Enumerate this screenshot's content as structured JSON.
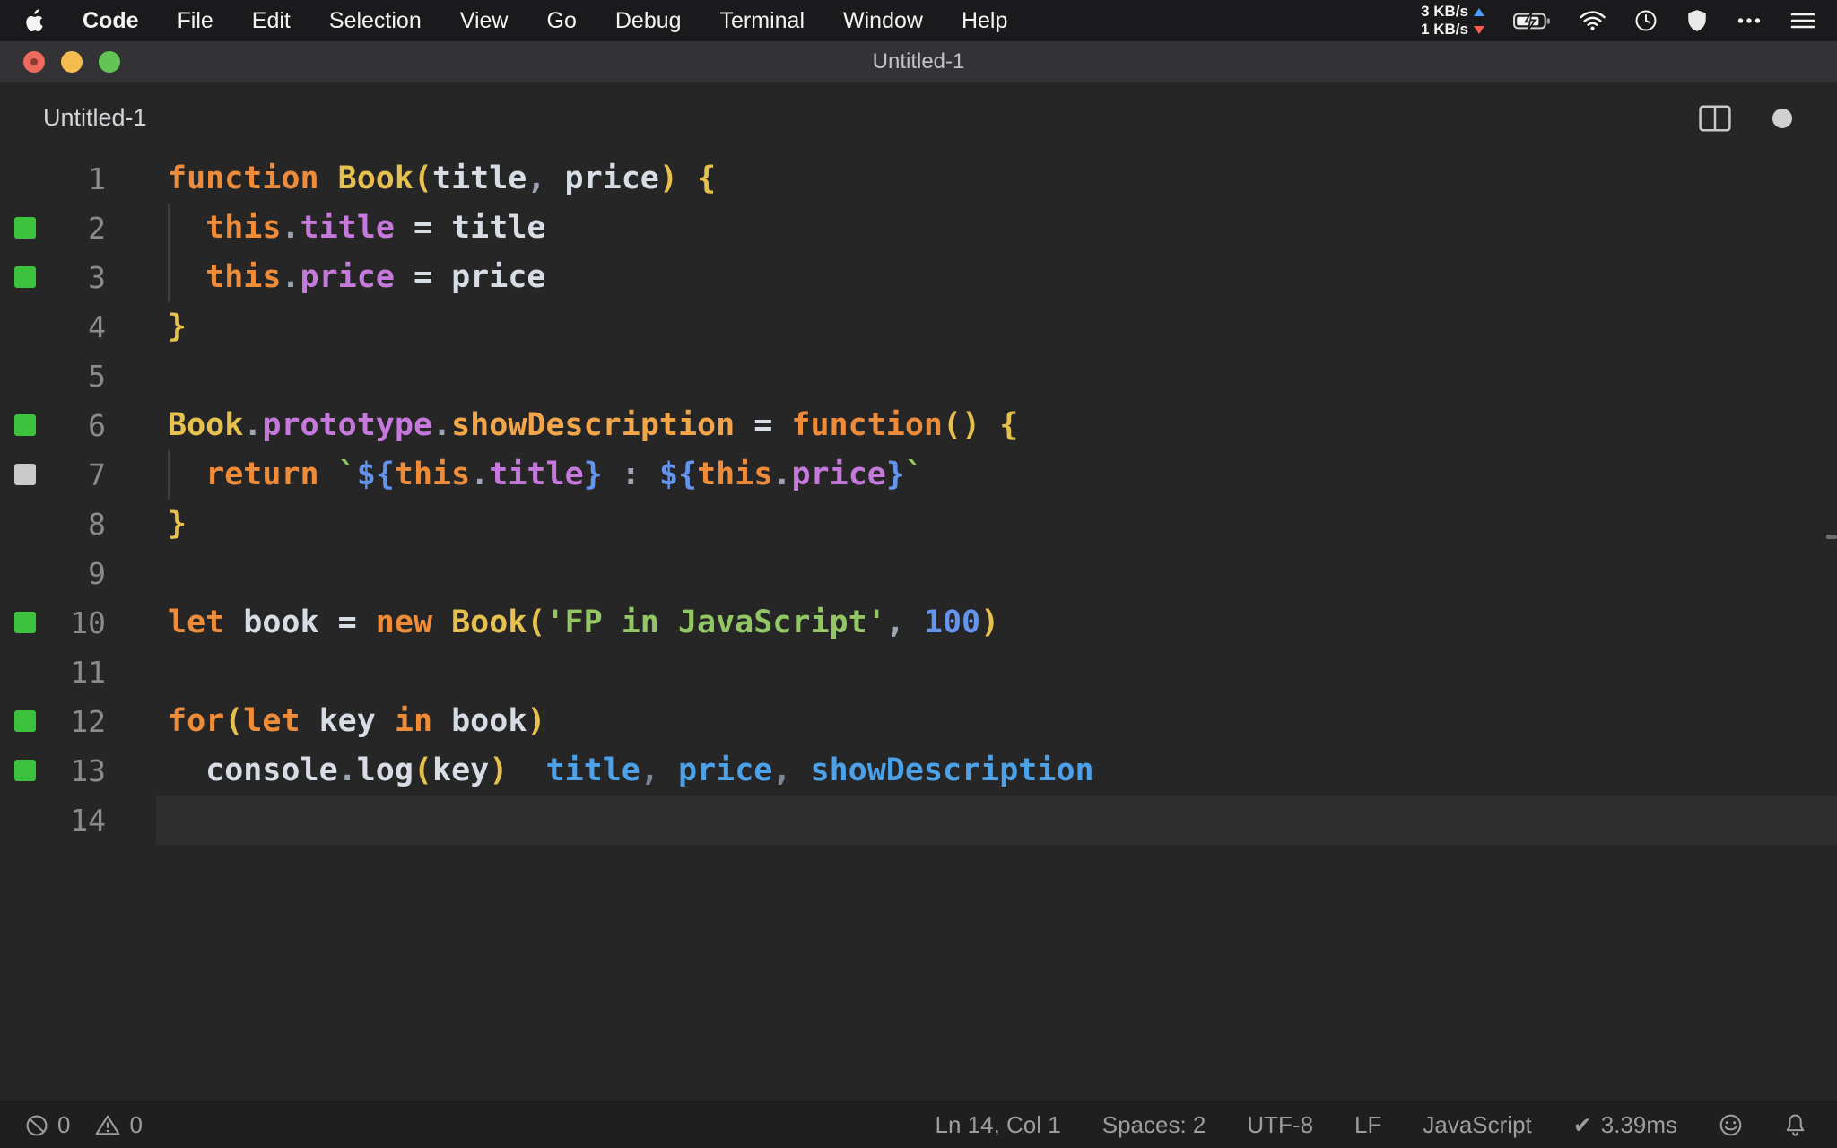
{
  "menubar": {
    "app_menu": "Code",
    "items": [
      "File",
      "Edit",
      "Selection",
      "View",
      "Go",
      "Debug",
      "Terminal",
      "Window",
      "Help"
    ],
    "net_up": "3 KB/s",
    "net_down": "1 KB/s"
  },
  "titlebar": {
    "title": "Untitled-1"
  },
  "editor_header": {
    "title": "Untitled-1"
  },
  "editor": {
    "lines": [
      {
        "n": "1",
        "sq": "",
        "segs": [
          [
            "kw",
            "function"
          ],
          [
            "pl",
            " "
          ],
          [
            "yel",
            "Book("
          ],
          [
            "pl",
            "title"
          ],
          [
            "pun",
            ","
          ],
          [
            "pl",
            " price"
          ],
          [
            "yel",
            ")"
          ],
          [
            "pl",
            " "
          ],
          [
            "yel",
            "{"
          ]
        ]
      },
      {
        "n": "2",
        "sq": "green",
        "guide": true,
        "segs": [
          [
            "pl",
            "  "
          ],
          [
            "kw",
            "this"
          ],
          [
            "pun",
            "."
          ],
          [
            "prop",
            "title"
          ],
          [
            "pl",
            " = title"
          ]
        ]
      },
      {
        "n": "3",
        "sq": "green",
        "guide": true,
        "segs": [
          [
            "pl",
            "  "
          ],
          [
            "kw",
            "this"
          ],
          [
            "pun",
            "."
          ],
          [
            "prop",
            "price"
          ],
          [
            "pl",
            " = price"
          ]
        ]
      },
      {
        "n": "4",
        "sq": "",
        "segs": [
          [
            "yel",
            "}"
          ]
        ]
      },
      {
        "n": "5",
        "sq": "",
        "segs": []
      },
      {
        "n": "6",
        "sq": "green",
        "segs": [
          [
            "yel",
            "Book"
          ],
          [
            "pun",
            "."
          ],
          [
            "prop",
            "prototype"
          ],
          [
            "pun",
            "."
          ],
          [
            "meth",
            "showDescription"
          ],
          [
            "pl",
            " = "
          ],
          [
            "kw",
            "function"
          ],
          [
            "yel",
            "()"
          ],
          [
            "pl",
            " "
          ],
          [
            "yel",
            "{"
          ]
        ]
      },
      {
        "n": "7",
        "sq": "gray",
        "guide": true,
        "segs": [
          [
            "pl",
            "  "
          ],
          [
            "kw",
            "return"
          ],
          [
            "pl",
            " "
          ],
          [
            "str",
            "`"
          ],
          [
            "tpl",
            "${"
          ],
          [
            "kw",
            "this"
          ],
          [
            "pun",
            "."
          ],
          [
            "prop",
            "title"
          ],
          [
            "tpl",
            "}"
          ],
          [
            "pl",
            " "
          ],
          [
            "pun",
            ":"
          ],
          [
            "pl",
            " "
          ],
          [
            "tpl",
            "${"
          ],
          [
            "kw",
            "this"
          ],
          [
            "pun",
            "."
          ],
          [
            "prop",
            "price"
          ],
          [
            "tpl",
            "}"
          ],
          [
            "str",
            "`"
          ]
        ]
      },
      {
        "n": "8",
        "sq": "",
        "segs": [
          [
            "yel",
            "}"
          ]
        ]
      },
      {
        "n": "9",
        "sq": "",
        "segs": []
      },
      {
        "n": "10",
        "sq": "green",
        "segs": [
          [
            "kw",
            "let"
          ],
          [
            "pl",
            " book = "
          ],
          [
            "kw",
            "new"
          ],
          [
            "pl",
            " "
          ],
          [
            "yel",
            "Book("
          ],
          [
            "str",
            "'FP in JavaScript'"
          ],
          [
            "pun",
            ","
          ],
          [
            "pl",
            " "
          ],
          [
            "num",
            "100"
          ],
          [
            "yel",
            ")"
          ]
        ]
      },
      {
        "n": "11",
        "sq": "",
        "segs": []
      },
      {
        "n": "12",
        "sq": "green",
        "segs": [
          [
            "kw",
            "for"
          ],
          [
            "yel",
            "("
          ],
          [
            "kw",
            "let"
          ],
          [
            "pl",
            " key "
          ],
          [
            "kw",
            "in"
          ],
          [
            "pl",
            " book"
          ],
          [
            "yel",
            ")"
          ]
        ]
      },
      {
        "n": "13",
        "sq": "green",
        "segs": [
          [
            "pl",
            "  console"
          ],
          [
            "pun",
            "."
          ],
          [
            "pl",
            "log"
          ],
          [
            "yel",
            "("
          ],
          [
            "pl",
            "key"
          ],
          [
            "yel",
            ")"
          ],
          [
            "pl",
            "  "
          ],
          [
            "out",
            "title"
          ],
          [
            "opun",
            ","
          ],
          [
            "out",
            " price"
          ],
          [
            "opun",
            ","
          ],
          [
            "out",
            " showDescription"
          ]
        ]
      },
      {
        "n": "14",
        "sq": "",
        "cur": true,
        "segs": []
      }
    ]
  },
  "statusbar": {
    "errors": "0",
    "warnings": "0",
    "cursor_position": "Ln 14, Col 1",
    "indentation": "Spaces: 2",
    "encoding": "UTF-8",
    "eol": "LF",
    "language": "JavaScript",
    "check": "✔",
    "quokka_time": "3.39ms"
  },
  "icons": {
    "apple": "apple-logo",
    "net_up": "upload-arrow",
    "net_down": "download-arrow",
    "battery": "battery-charging",
    "wifi": "wifi",
    "clock": "clock",
    "shield": "shield",
    "more": "ellipsis",
    "list": "menu-lines",
    "split_editor": "split-editor",
    "modified": "modified-dot",
    "errors": "circle-slash",
    "warnings": "warning-triangle",
    "quokka": "check",
    "feedback": "smiley",
    "notifications": "bell"
  },
  "colors": {
    "menubar_bg": "#1a1a1c",
    "titlebar_bg": "#333336",
    "editor_bg": "#262626",
    "current_line_bg": "#2e2e2f",
    "statusbar_bg": "#1f1f20",
    "statusbar_fg": "#9d9d9d",
    "line_number": "#8b8b8b",
    "keyword": "#ef8c3a",
    "class_name": "#e6c14e",
    "property": "#c678dd",
    "method": "#f2a649",
    "plain": "#d8dce4",
    "punctuation": "#9da5b4",
    "string": "#93c763",
    "number": "#6494ed",
    "template_delim": "#6494ed",
    "quokka_output": "#4da1e8",
    "quokka_output_punct": "#7d8796",
    "coverage_green": "#3cc23c",
    "coverage_gray": "#c9c9c9",
    "traffic_red": "#ee6a5f",
    "traffic_yellow": "#f5bd4f",
    "traffic_green": "#61c454",
    "net_up_arrow": "#4a9eff",
    "net_down_arrow": "#ff5b51"
  }
}
